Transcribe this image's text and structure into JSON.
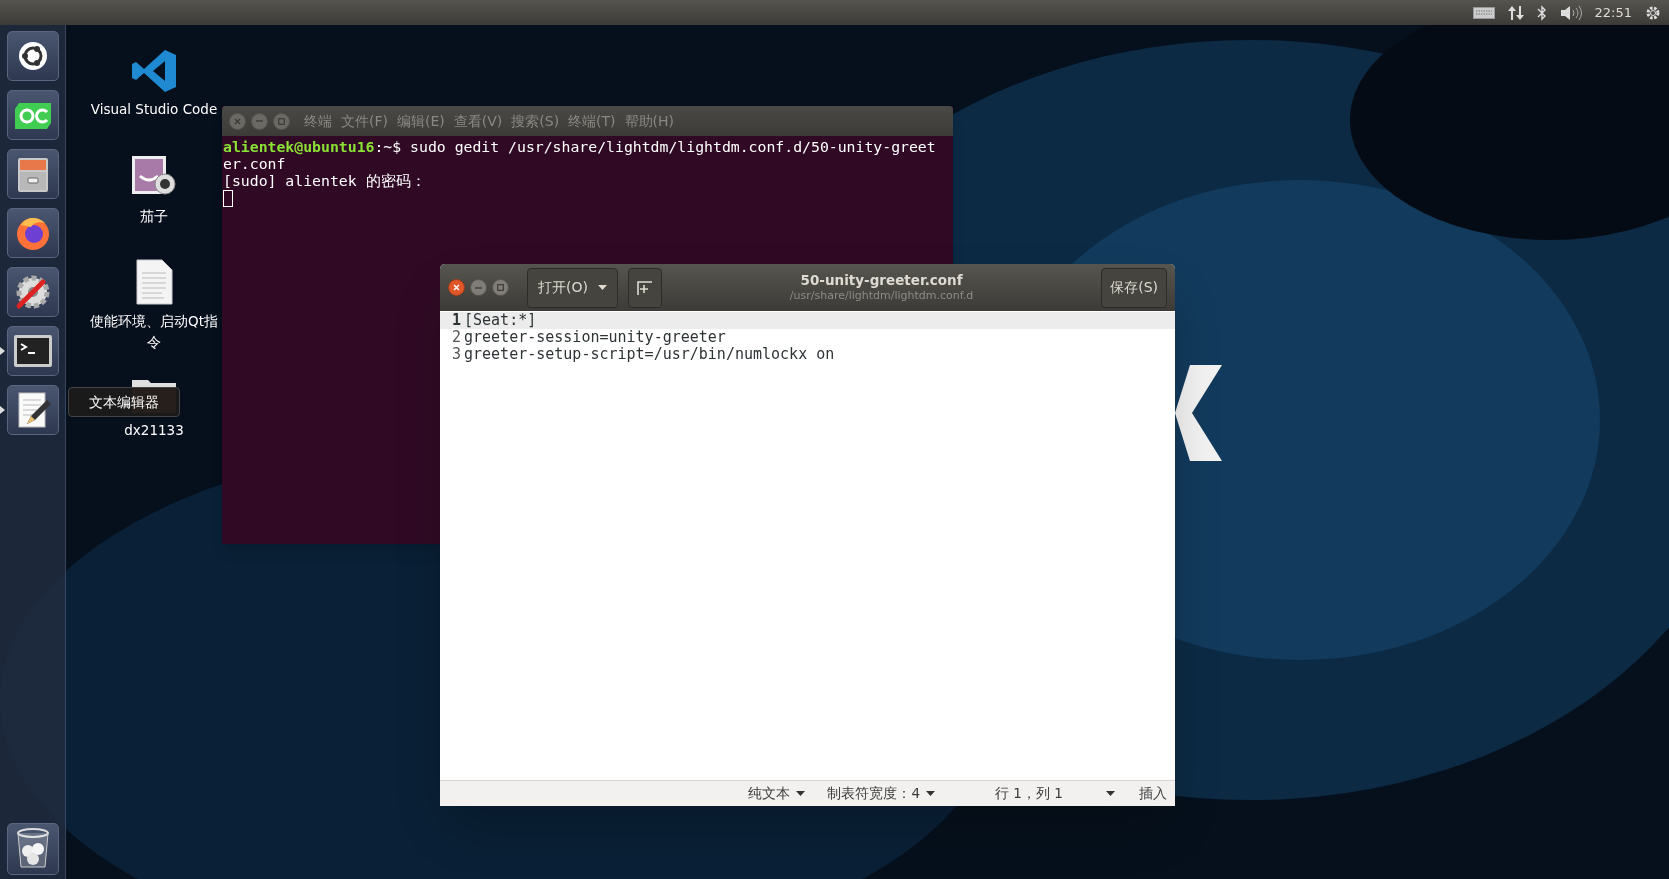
{
  "top_bar": {
    "time": "22:51"
  },
  "launcher": {
    "items": [
      {
        "kind": "ubuntu",
        "running": false
      },
      {
        "kind": "qtcreator",
        "running": false
      },
      {
        "kind": "files",
        "running": false
      },
      {
        "kind": "firefox",
        "running": false
      },
      {
        "kind": "settings",
        "running": false
      },
      {
        "kind": "terminal",
        "running": true
      },
      {
        "kind": "editor",
        "running": true
      }
    ],
    "trash": {
      "kind": "trash"
    },
    "tooltip": "文本编辑器"
  },
  "desktop_icons": [
    {
      "kind": "vscode",
      "label": "Visual Studio Code"
    },
    {
      "kind": "cheese",
      "label": "茄子"
    },
    {
      "kind": "document",
      "label": "使能环境、启动Qt指令"
    },
    {
      "kind": "folder",
      "label": "dx21133"
    }
  ],
  "terminal": {
    "title": "终端",
    "menu": [
      "文件(F)",
      "编辑(E)",
      "查看(V)",
      "搜索(S)",
      "终端(T)",
      "帮助(H)"
    ],
    "lines": [
      {
        "prompt": "alientek@ubuntu16",
        "text": ":~$ sudo gedit /usr/share/lightdm/lightdm.conf.d/50-unity-greet"
      },
      {
        "text": "er.conf"
      },
      {
        "text": "[sudo] alientek 的密码："
      }
    ]
  },
  "editor": {
    "title": "50-unity-greeter.conf",
    "subtitle": "/usr/share/lightdm/lightdm.conf.d",
    "open_button": "打开(O)",
    "save_button": "保存(S)",
    "lines": [
      {
        "number": "1",
        "text": "[Seat:*]",
        "selected": true
      },
      {
        "number": "2",
        "text": "greeter-session=unity-greeter",
        "selected": false
      },
      {
        "number": "3",
        "text": "greeter-setup-script=/usr/bin/numlockx on",
        "selected": false
      }
    ],
    "status": {
      "language": "纯文本",
      "tab_width": "制表符宽度：4",
      "position": "行 1，列 1",
      "mode": "插入"
    }
  }
}
